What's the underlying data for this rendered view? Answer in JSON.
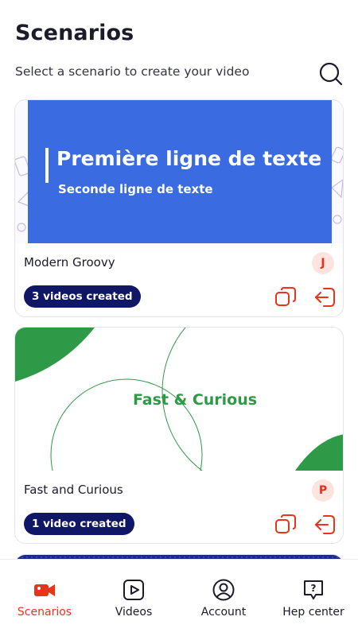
{
  "header": {
    "title": "Scenarios",
    "subtitle": "Select a scenario to create your video",
    "search_icon": "search-icon"
  },
  "scenarios": [
    {
      "preview_line1": "Première ligne de texte",
      "preview_line2": "Seconde ligne de texte",
      "title": "Modern Groovy",
      "author_initial": "J",
      "videos_label": "3 videos created",
      "actions": [
        "duplicate-icon",
        "open-icon"
      ]
    },
    {
      "preview_text": "Fast & Curious",
      "title": "Fast and Curious",
      "author_initial": "P",
      "videos_label": "1 video created",
      "actions": [
        "duplicate-icon",
        "open-icon"
      ]
    }
  ],
  "nav": {
    "items": [
      {
        "label": "Scenarios",
        "icon": "video-camera-icon",
        "active": true
      },
      {
        "label": "Videos",
        "icon": "play-icon",
        "active": false
      },
      {
        "label": "Account",
        "icon": "user-icon",
        "active": false
      },
      {
        "label": "Hep center",
        "icon": "help-icon",
        "active": false
      }
    ]
  },
  "colors": {
    "accent": "#e8341c",
    "badge": "#101766",
    "preview_blue": "#3b6be0",
    "preview_green": "#2e9a48"
  }
}
